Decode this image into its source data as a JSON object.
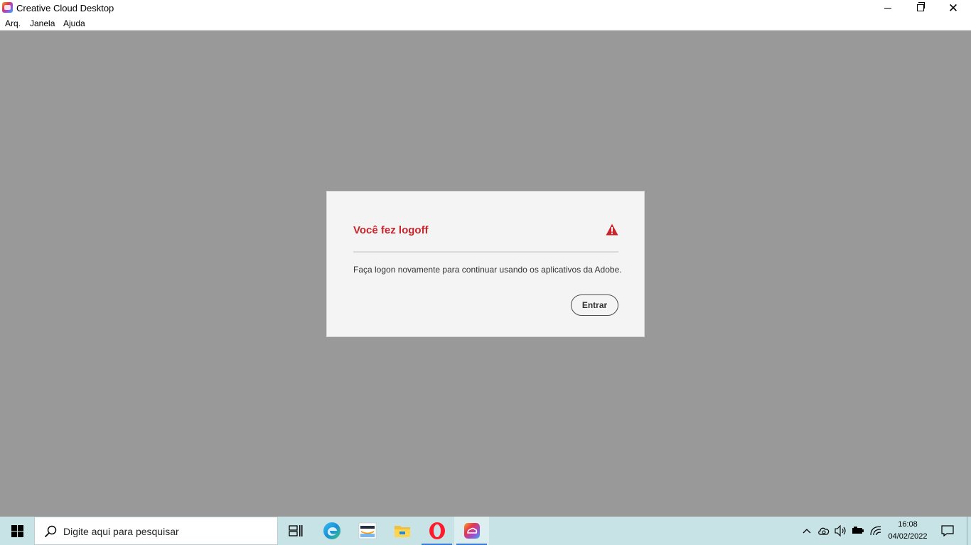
{
  "window": {
    "title": "Creative Cloud Desktop"
  },
  "menubar": {
    "items": [
      "Arq.",
      "Janela",
      "Ajuda"
    ]
  },
  "dialog": {
    "title": "Você fez logoff",
    "message": "Faça logon novamente para continuar usando os aplicativos da Adobe.",
    "button_label": "Entrar",
    "icon": "warning-icon"
  },
  "taskbar": {
    "search_placeholder": "Digite aqui para pesquisar",
    "apps": [
      "task-view-icon",
      "edge-icon",
      "amazon-icon",
      "file-explorer-icon",
      "opera-icon",
      "creative-cloud-icon"
    ],
    "tray_icons": [
      "chevron-up-icon",
      "cloud-sync-icon",
      "volume-icon",
      "battery-icon",
      "wifi-icon"
    ],
    "clock": {
      "time": "16:08",
      "date": "04/02/2022"
    }
  },
  "colors": {
    "background": "#999999",
    "dialog_bg": "#f4f4f4",
    "title_red": "#c9252c",
    "taskbar": "#c7e3e6"
  }
}
